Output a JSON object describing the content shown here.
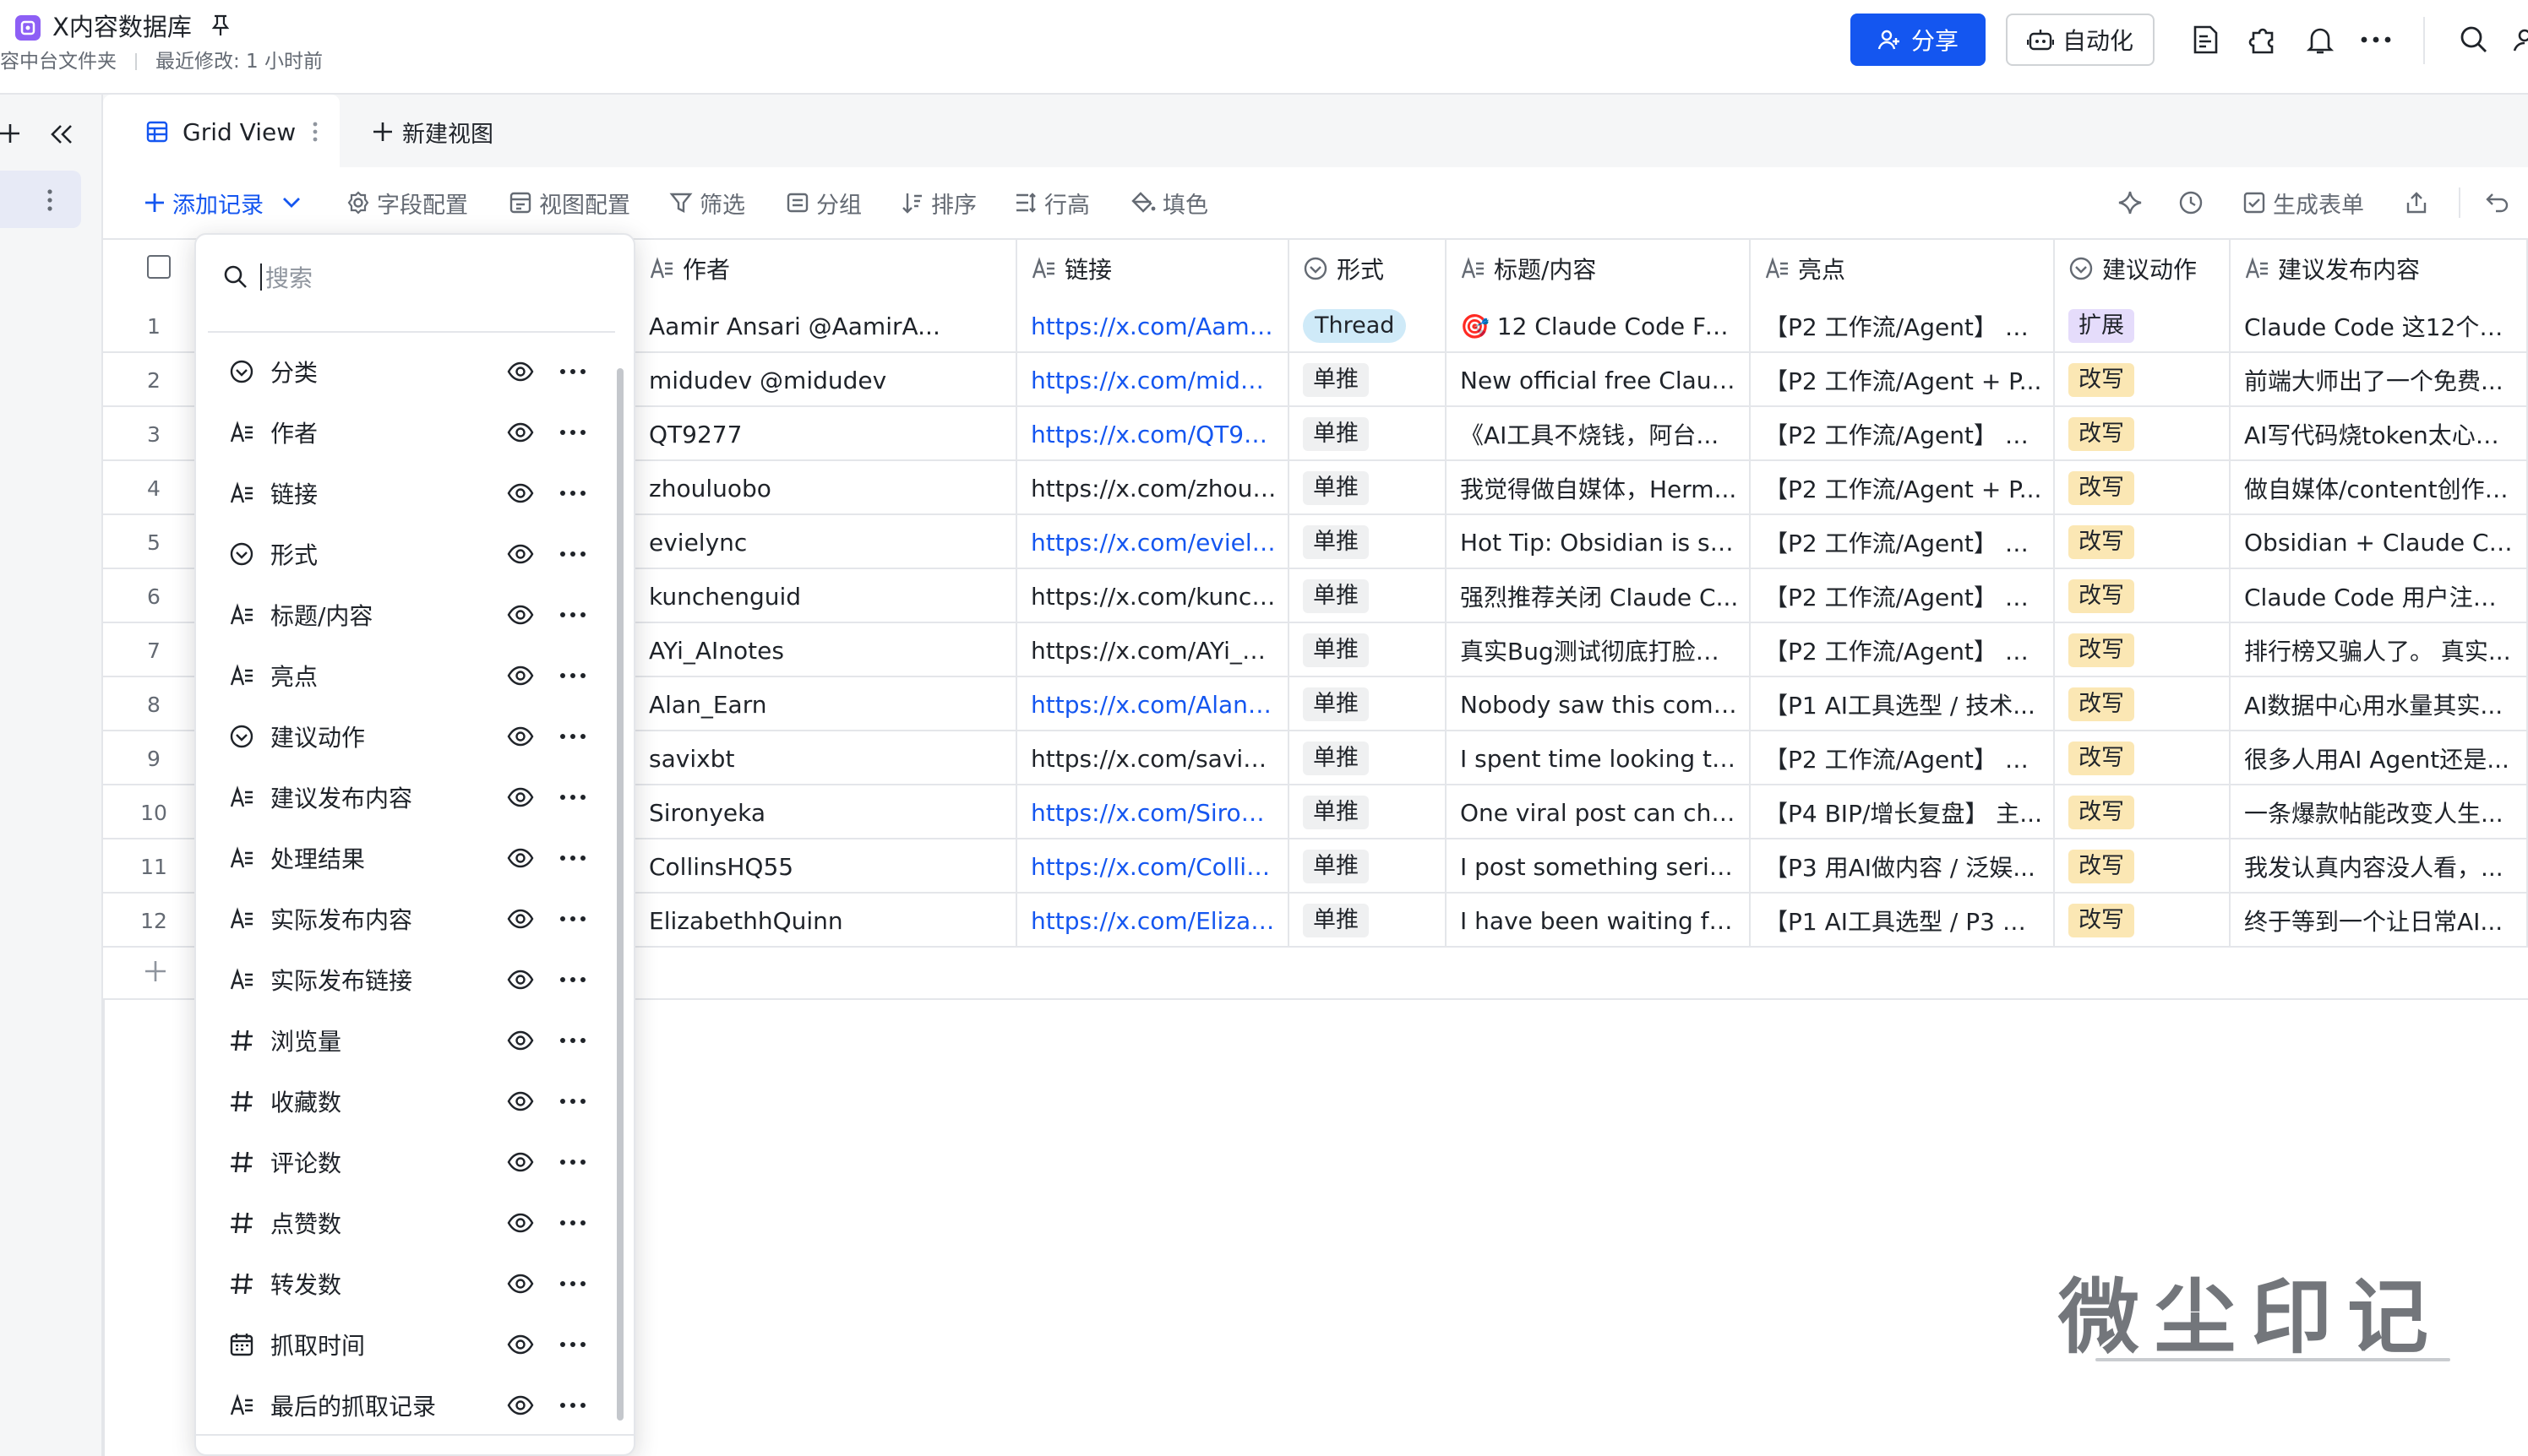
{
  "app": {
    "title": "X内容数据库",
    "breadcrumb_folder": "容中台文件夹",
    "last_modified": "最近修改: 1 小时前"
  },
  "top_actions": {
    "share_label": "分享",
    "automation_label": "自动化"
  },
  "tabs": {
    "active_label": "Grid View",
    "new_view_label": "新建视图"
  },
  "toolbar": {
    "add_record": "添加记录",
    "field_config": "字段配置",
    "view_config": "视图配置",
    "filter": "筛选",
    "group": "分组",
    "sort": "排序",
    "row_height": "行高",
    "fill_color": "填色",
    "generate_form": "生成表单"
  },
  "columns": [
    {
      "label": "作者",
      "icon": "text-icon"
    },
    {
      "label": "链接",
      "icon": "text-icon"
    },
    {
      "label": "形式",
      "icon": "select-icon"
    },
    {
      "label": "标题/内容",
      "icon": "text-icon"
    },
    {
      "label": "亮点",
      "icon": "text-icon"
    },
    {
      "label": "建议动作",
      "icon": "select-icon"
    },
    {
      "label": "建议发布内容",
      "icon": "text-icon"
    }
  ],
  "rows": [
    {
      "n": "1",
      "author": "Aamir Ansari @AamirA...",
      "link": "https://x.com/Aamir...",
      "link_colored": true,
      "form": "Thread",
      "title": "🎯 12 Claude Code Fea...",
      "highlight": "【P2 工作流/Agent】 主...",
      "action": "扩展",
      "content": "Claude Code 这12个功..."
    },
    {
      "n": "2",
      "author": "midudev @midudev",
      "link": "https://x.com/midud...",
      "link_colored": true,
      "form": "单推",
      "title": "New official free Claud...",
      "highlight": "【P2 工作流/Agent + P...",
      "action": "改写",
      "content": "前端大师出了一个免费..."
    },
    {
      "n": "3",
      "author": "QT9277",
      "link": "https://x.com/QT92...",
      "link_colored": true,
      "form": "单推",
      "title": "《AI工具不烧钱，阿台...",
      "highlight": "【P2 工作流/Agent】 主...",
      "action": "改写",
      "content": "AI写代码烧token太心疼..."
    },
    {
      "n": "4",
      "author": "zhouluobo",
      "link": "https://x.com/zhoulu...",
      "link_colored": false,
      "form": "单推",
      "title": "我觉得做自媒体，Herm...",
      "highlight": "【P2 工作流/Agent + P...",
      "action": "改写",
      "content": "做自媒体/content创作，..."
    },
    {
      "n": "5",
      "author": "evielync",
      "link": "https://x.com/eviely...",
      "link_colored": true,
      "form": "单推",
      "title": "Hot Tip: Obsidian is so ...",
      "highlight": "【P2 工作流/Agent】 主...",
      "action": "改写",
      "content": "Obsidian + Claude Cod..."
    },
    {
      "n": "6",
      "author": "kunchenguid",
      "link": "https://x.com/kunch...",
      "link_colored": false,
      "form": "单推",
      "title": "强烈推荐关闭 Claude C...",
      "highlight": "【P2 工作流/Agent】 主...",
      "action": "改写",
      "content": "Claude Code 用户注意..."
    },
    {
      "n": "7",
      "author": "AYi_AInotes",
      "link": "https://x.com/AYi_AI...",
      "link_colored": false,
      "form": "单推",
      "title": "真实Bug测试彻底打脸排...",
      "highlight": "【P2 工作流/Agent】 主...",
      "action": "改写",
      "content": "排行榜又骗人了。 真实..."
    },
    {
      "n": "8",
      "author": "Alan_Earn",
      "link": "https://x.com/Alan_...",
      "link_colored": true,
      "form": "单推",
      "title": "Nobody saw this comin...",
      "highlight": "【P1 AI工具选型 / 技术...",
      "action": "改写",
      "content": "AI数据中心用水量其实..."
    },
    {
      "n": "9",
      "author": "savixbt",
      "link": "https://x.com/savixb...",
      "link_colored": false,
      "form": "单推",
      "title": "I spent time looking thr...",
      "highlight": "【P2 工作流/Agent】 主...",
      "action": "改写",
      "content": "很多人用AI Agent还是..."
    },
    {
      "n": "10",
      "author": "Sironyeka",
      "link": "https://x.com/Sirony...",
      "link_colored": true,
      "form": "单推",
      "title": "One viral post can chan...",
      "highlight": "【P4 BIP/增长复盘】 主...",
      "action": "改写",
      "content": "一条爆款帖能改变人生..."
    },
    {
      "n": "11",
      "author": "CollinsHQ55",
      "link": "https://x.com/Collins...",
      "link_colored": true,
      "form": "单推",
      "title": "I post something seriou...",
      "highlight": "【P3 用AI做内容 / 泛娱...",
      "action": "改写",
      "content": "我发认真内容没人看，..."
    },
    {
      "n": "12",
      "author": "ElizabethhQuinn",
      "link": "https://x.com/Elizab...",
      "link_colored": true,
      "form": "单推",
      "title": "I have been waiting for ...",
      "highlight": "【P1 AI工具选型 / P3 用...",
      "action": "改写",
      "content": "终于等到一个让日常AI..."
    }
  ],
  "field_panel": {
    "search_placeholder": "搜索",
    "fields": [
      {
        "label": "分类",
        "icon": "select-icon"
      },
      {
        "label": "作者",
        "icon": "text-icon"
      },
      {
        "label": "链接",
        "icon": "text-icon"
      },
      {
        "label": "形式",
        "icon": "select-icon"
      },
      {
        "label": "标题/内容",
        "icon": "text-icon"
      },
      {
        "label": "亮点",
        "icon": "text-icon"
      },
      {
        "label": "建议动作",
        "icon": "select-icon"
      },
      {
        "label": "建议发布内容",
        "icon": "text-icon"
      },
      {
        "label": "处理结果",
        "icon": "text-icon"
      },
      {
        "label": "实际发布内容",
        "icon": "text-icon"
      },
      {
        "label": "实际发布链接",
        "icon": "text-icon"
      },
      {
        "label": "浏览量",
        "icon": "number-icon"
      },
      {
        "label": "收藏数",
        "icon": "number-icon"
      },
      {
        "label": "评论数",
        "icon": "number-icon"
      },
      {
        "label": "点赞数",
        "icon": "number-icon"
      },
      {
        "label": "转发数",
        "icon": "number-icon"
      },
      {
        "label": "抓取时间",
        "icon": "date-icon"
      },
      {
        "label": "最后的抓取记录",
        "icon": "text-icon"
      }
    ]
  },
  "watermark": "微尘印记",
  "colors": {
    "accent": "#1456f0",
    "tag_thread": "#cfeaf8",
    "tag_expand": "#e5dcfb",
    "tag_rewrite": "#fbe7b4",
    "tag_single": "#eff0f1"
  }
}
